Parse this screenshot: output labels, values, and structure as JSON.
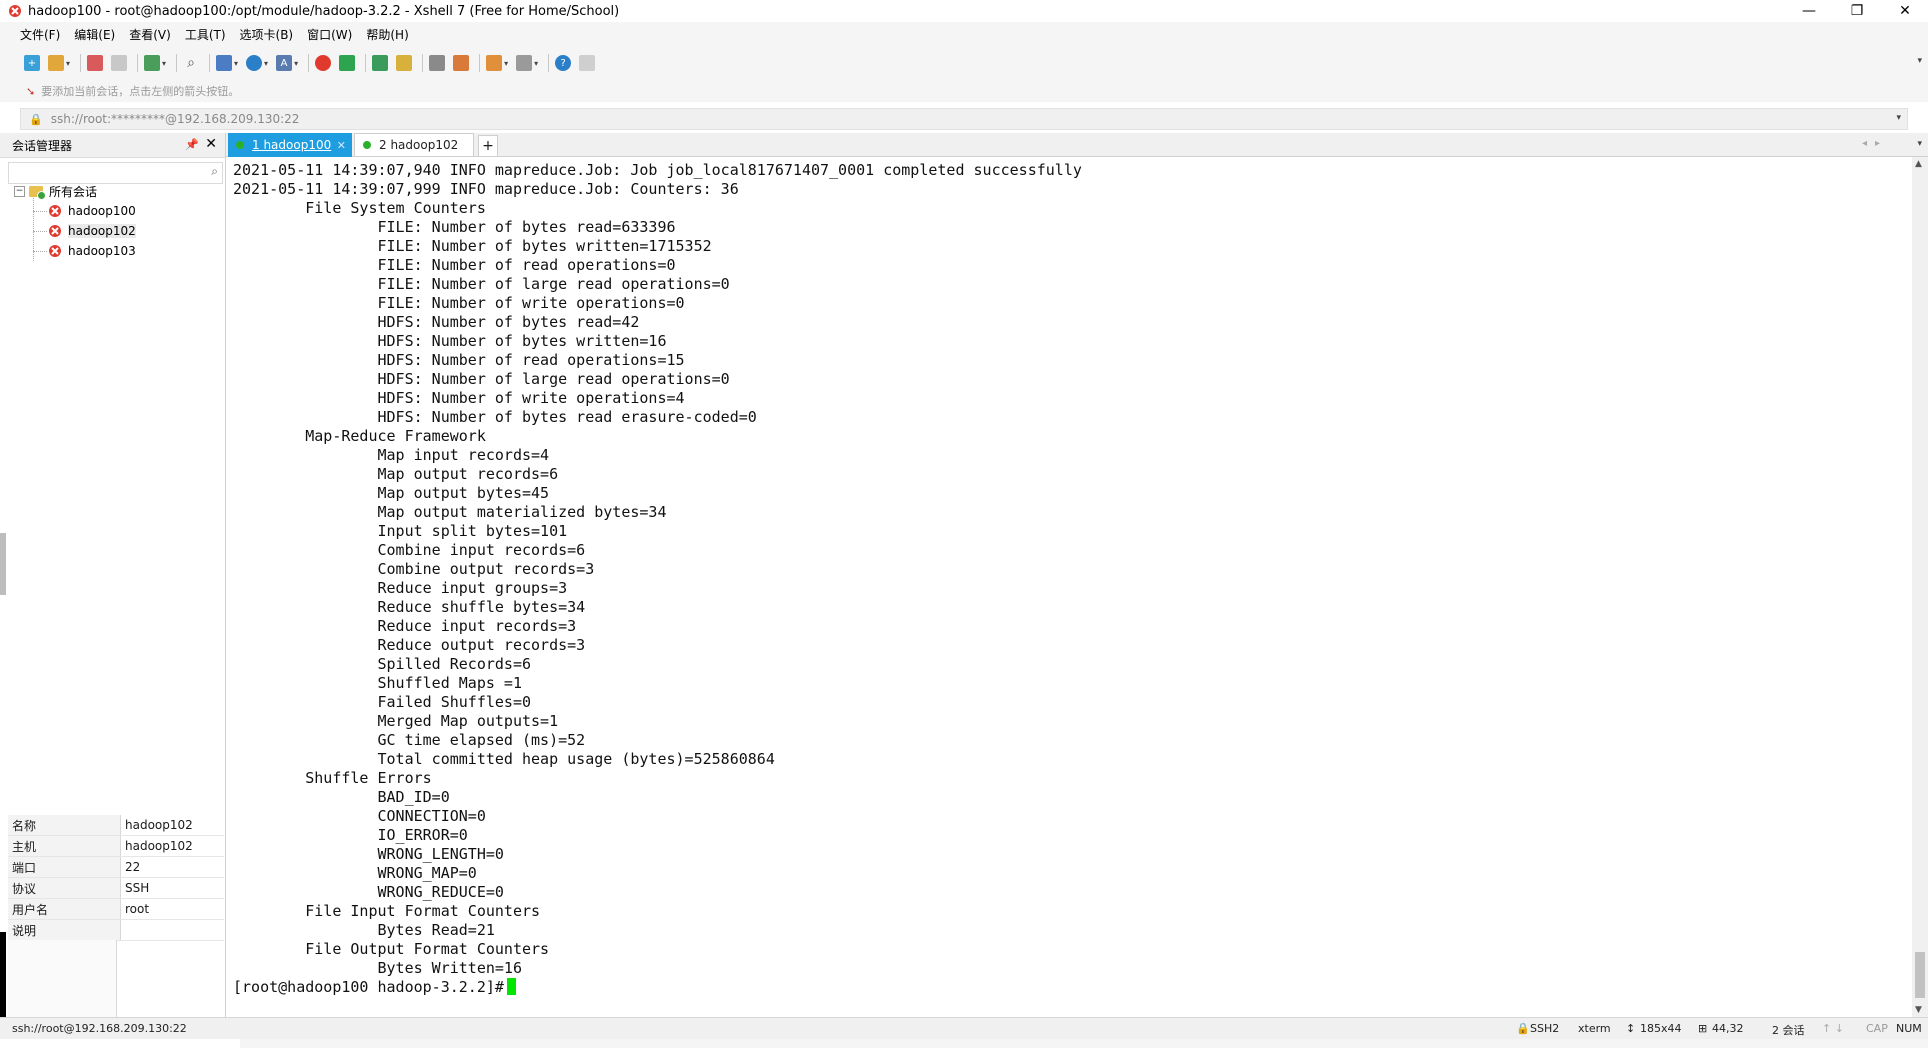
{
  "window": {
    "title": "hadoop100 - root@hadoop100:/opt/module/hadoop-3.2.2 - Xshell 7 (Free for Home/School)",
    "minimize": "—",
    "restore": "❐",
    "close": "✕"
  },
  "menu": [
    "文件(F)",
    "编辑(E)",
    "查看(V)",
    "工具(T)",
    "选项卡(B)",
    "窗口(W)",
    "帮助(H)"
  ],
  "hint": "要添加当前会话，点击左侧的箭头按钮。",
  "address": "ssh://root:*********@192.168.209.130:22",
  "session_manager": {
    "title": "会话管理器",
    "root": "所有会话",
    "sessions": [
      "hadoop100",
      "hadoop102",
      "hadoop103"
    ]
  },
  "properties": [
    {
      "key": "名称",
      "value": "hadoop102"
    },
    {
      "key": "主机",
      "value": "hadoop102"
    },
    {
      "key": "端口",
      "value": "22"
    },
    {
      "key": "协议",
      "value": "SSH"
    },
    {
      "key": "用户名",
      "value": "root"
    },
    {
      "key": "说明",
      "value": ""
    }
  ],
  "tabs": [
    {
      "label": "1 hadoop100",
      "active": true
    },
    {
      "label": "2 hadoop102",
      "active": false
    }
  ],
  "terminal": {
    "lines": [
      "2021-05-11 14:39:07,940 INFO mapreduce.Job: Job job_local817671407_0001 completed successfully",
      "2021-05-11 14:39:07,999 INFO mapreduce.Job: Counters: 36",
      "\tFile System Counters",
      "\t\tFILE: Number of bytes read=633396",
      "\t\tFILE: Number of bytes written=1715352",
      "\t\tFILE: Number of read operations=0",
      "\t\tFILE: Number of large read operations=0",
      "\t\tFILE: Number of write operations=0",
      "\t\tHDFS: Number of bytes read=42",
      "\t\tHDFS: Number of bytes written=16",
      "\t\tHDFS: Number of read operations=15",
      "\t\tHDFS: Number of large read operations=0",
      "\t\tHDFS: Number of write operations=4",
      "\t\tHDFS: Number of bytes read erasure-coded=0",
      "\tMap-Reduce Framework",
      "\t\tMap input records=4",
      "\t\tMap output records=6",
      "\t\tMap output bytes=45",
      "\t\tMap output materialized bytes=34",
      "\t\tInput split bytes=101",
      "\t\tCombine input records=6",
      "\t\tCombine output records=3",
      "\t\tReduce input groups=3",
      "\t\tReduce shuffle bytes=34",
      "\t\tReduce input records=3",
      "\t\tReduce output records=3",
      "\t\tSpilled Records=6",
      "\t\tShuffled Maps =1",
      "\t\tFailed Shuffles=0",
      "\t\tMerged Map outputs=1",
      "\t\tGC time elapsed (ms)=52",
      "\t\tTotal committed heap usage (bytes)=525860864",
      "\tShuffle Errors",
      "\t\tBAD_ID=0",
      "\t\tCONNECTION=0",
      "\t\tIO_ERROR=0",
      "\t\tWRONG_LENGTH=0",
      "\t\tWRONG_MAP=0",
      "\t\tWRONG_REDUCE=0",
      "\tFile Input Format Counters",
      "\t\tBytes Read=21",
      "\tFile Output Format Counters",
      "\t\tBytes Written=16"
    ],
    "prompt": "[root@hadoop100 hadoop-3.2.2]# "
  },
  "status": {
    "connection": "ssh://root@192.168.209.130:22",
    "protocol": "SSH2",
    "terminal_type": "xterm",
    "size": "185x44",
    "position": "44,32",
    "sessions": "2 会话",
    "cap": "CAP",
    "num": "NUM"
  },
  "colors": {
    "active_tab": "#1e9de0",
    "tab_dot": "#2bb02b",
    "cursor": "#00e600",
    "session_icon": "#e03a2f"
  },
  "icons": [
    "xshell-logo-icon",
    "new-session-icon",
    "open-folder-icon",
    "lock-icon",
    "search-icon",
    "help-icon",
    "session-icon"
  ]
}
